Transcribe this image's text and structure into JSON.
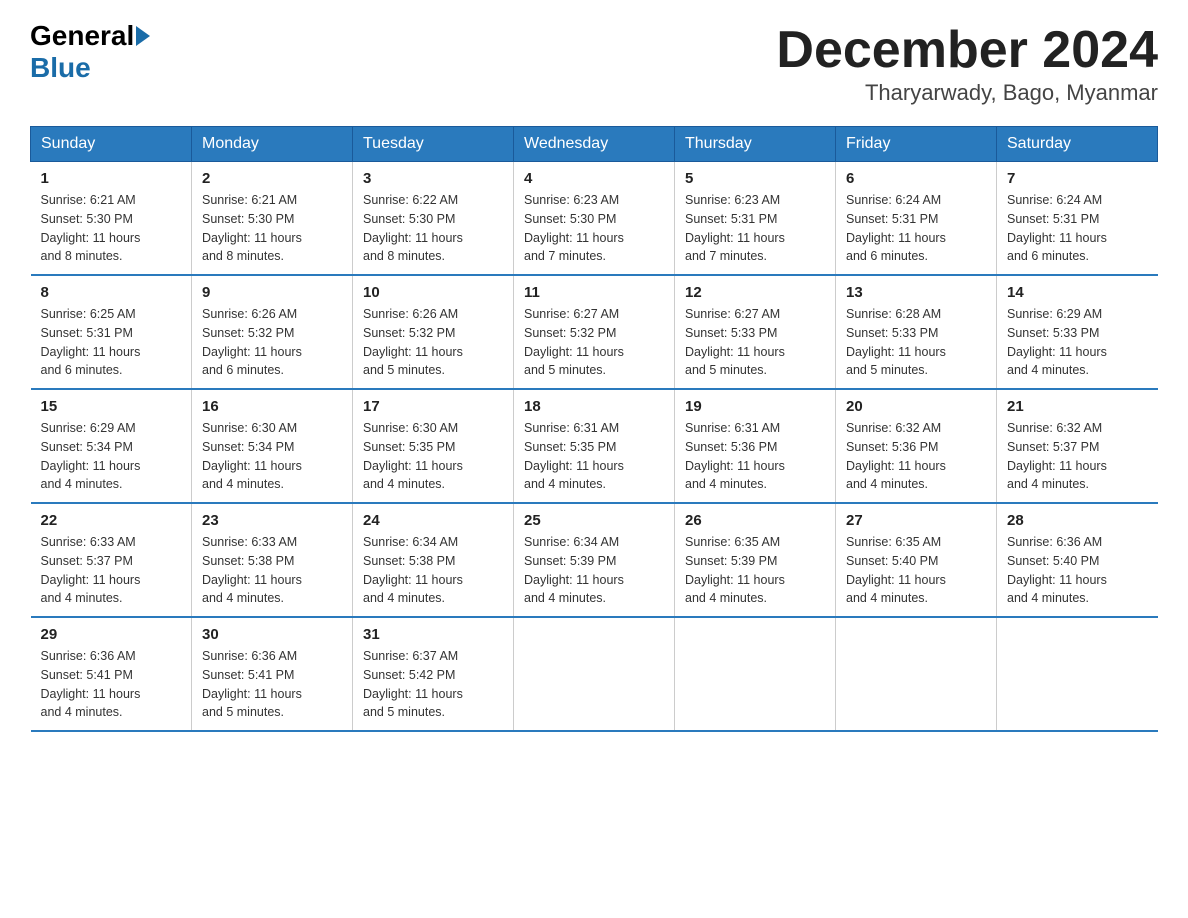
{
  "header": {
    "logo_general": "General",
    "logo_blue": "Blue",
    "month_title": "December 2024",
    "location": "Tharyarwady, Bago, Myanmar"
  },
  "days_of_week": [
    "Sunday",
    "Monday",
    "Tuesday",
    "Wednesday",
    "Thursday",
    "Friday",
    "Saturday"
  ],
  "weeks": [
    [
      {
        "day": "1",
        "sunrise": "6:21 AM",
        "sunset": "5:30 PM",
        "daylight": "11 hours and 8 minutes."
      },
      {
        "day": "2",
        "sunrise": "6:21 AM",
        "sunset": "5:30 PM",
        "daylight": "11 hours and 8 minutes."
      },
      {
        "day": "3",
        "sunrise": "6:22 AM",
        "sunset": "5:30 PM",
        "daylight": "11 hours and 8 minutes."
      },
      {
        "day": "4",
        "sunrise": "6:23 AM",
        "sunset": "5:30 PM",
        "daylight": "11 hours and 7 minutes."
      },
      {
        "day": "5",
        "sunrise": "6:23 AM",
        "sunset": "5:31 PM",
        "daylight": "11 hours and 7 minutes."
      },
      {
        "day": "6",
        "sunrise": "6:24 AM",
        "sunset": "5:31 PM",
        "daylight": "11 hours and 6 minutes."
      },
      {
        "day": "7",
        "sunrise": "6:24 AM",
        "sunset": "5:31 PM",
        "daylight": "11 hours and 6 minutes."
      }
    ],
    [
      {
        "day": "8",
        "sunrise": "6:25 AM",
        "sunset": "5:31 PM",
        "daylight": "11 hours and 6 minutes."
      },
      {
        "day": "9",
        "sunrise": "6:26 AM",
        "sunset": "5:32 PM",
        "daylight": "11 hours and 6 minutes."
      },
      {
        "day": "10",
        "sunrise": "6:26 AM",
        "sunset": "5:32 PM",
        "daylight": "11 hours and 5 minutes."
      },
      {
        "day": "11",
        "sunrise": "6:27 AM",
        "sunset": "5:32 PM",
        "daylight": "11 hours and 5 minutes."
      },
      {
        "day": "12",
        "sunrise": "6:27 AM",
        "sunset": "5:33 PM",
        "daylight": "11 hours and 5 minutes."
      },
      {
        "day": "13",
        "sunrise": "6:28 AM",
        "sunset": "5:33 PM",
        "daylight": "11 hours and 5 minutes."
      },
      {
        "day": "14",
        "sunrise": "6:29 AM",
        "sunset": "5:33 PM",
        "daylight": "11 hours and 4 minutes."
      }
    ],
    [
      {
        "day": "15",
        "sunrise": "6:29 AM",
        "sunset": "5:34 PM",
        "daylight": "11 hours and 4 minutes."
      },
      {
        "day": "16",
        "sunrise": "6:30 AM",
        "sunset": "5:34 PM",
        "daylight": "11 hours and 4 minutes."
      },
      {
        "day": "17",
        "sunrise": "6:30 AM",
        "sunset": "5:35 PM",
        "daylight": "11 hours and 4 minutes."
      },
      {
        "day": "18",
        "sunrise": "6:31 AM",
        "sunset": "5:35 PM",
        "daylight": "11 hours and 4 minutes."
      },
      {
        "day": "19",
        "sunrise": "6:31 AM",
        "sunset": "5:36 PM",
        "daylight": "11 hours and 4 minutes."
      },
      {
        "day": "20",
        "sunrise": "6:32 AM",
        "sunset": "5:36 PM",
        "daylight": "11 hours and 4 minutes."
      },
      {
        "day": "21",
        "sunrise": "6:32 AM",
        "sunset": "5:37 PM",
        "daylight": "11 hours and 4 minutes."
      }
    ],
    [
      {
        "day": "22",
        "sunrise": "6:33 AM",
        "sunset": "5:37 PM",
        "daylight": "11 hours and 4 minutes."
      },
      {
        "day": "23",
        "sunrise": "6:33 AM",
        "sunset": "5:38 PM",
        "daylight": "11 hours and 4 minutes."
      },
      {
        "day": "24",
        "sunrise": "6:34 AM",
        "sunset": "5:38 PM",
        "daylight": "11 hours and 4 minutes."
      },
      {
        "day": "25",
        "sunrise": "6:34 AM",
        "sunset": "5:39 PM",
        "daylight": "11 hours and 4 minutes."
      },
      {
        "day": "26",
        "sunrise": "6:35 AM",
        "sunset": "5:39 PM",
        "daylight": "11 hours and 4 minutes."
      },
      {
        "day": "27",
        "sunrise": "6:35 AM",
        "sunset": "5:40 PM",
        "daylight": "11 hours and 4 minutes."
      },
      {
        "day": "28",
        "sunrise": "6:36 AM",
        "sunset": "5:40 PM",
        "daylight": "11 hours and 4 minutes."
      }
    ],
    [
      {
        "day": "29",
        "sunrise": "6:36 AM",
        "sunset": "5:41 PM",
        "daylight": "11 hours and 4 minutes."
      },
      {
        "day": "30",
        "sunrise": "6:36 AM",
        "sunset": "5:41 PM",
        "daylight": "11 hours and 5 minutes."
      },
      {
        "day": "31",
        "sunrise": "6:37 AM",
        "sunset": "5:42 PM",
        "daylight": "11 hours and 5 minutes."
      },
      null,
      null,
      null,
      null
    ]
  ],
  "labels": {
    "sunrise": "Sunrise:",
    "sunset": "Sunset:",
    "daylight": "Daylight:"
  }
}
